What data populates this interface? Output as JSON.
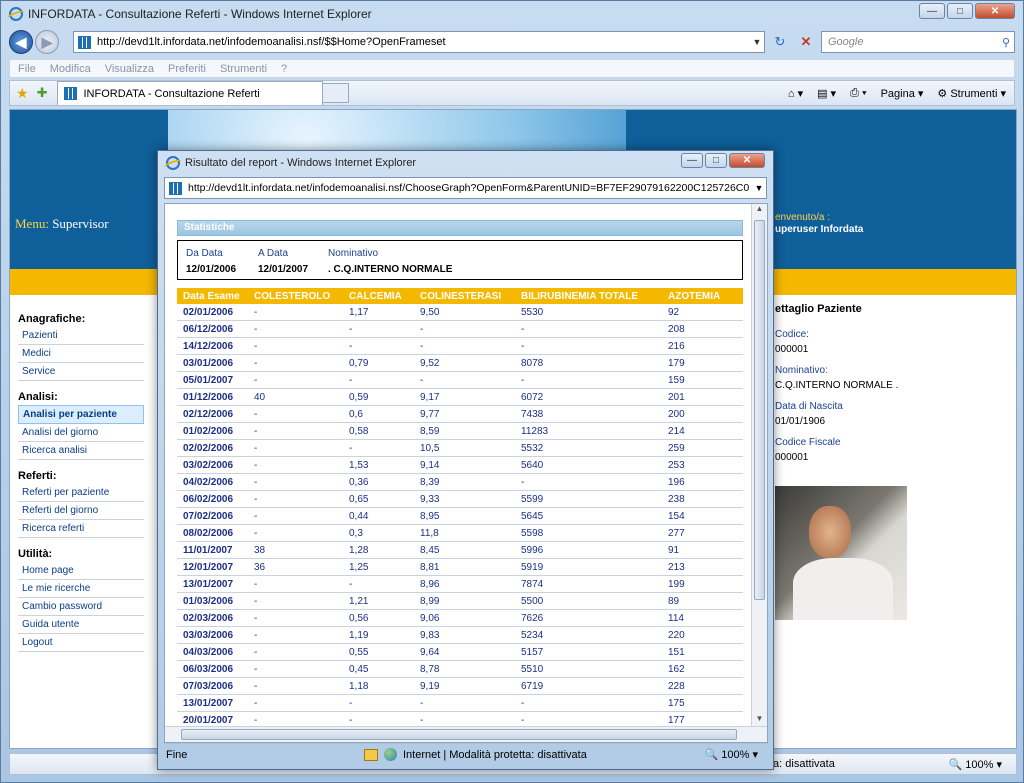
{
  "browser": {
    "title": "INFORDATA - Consultazione Referti - Windows Internet Explorer",
    "address": "http://devd1lt.infordata.net/infodemoanalisi.nsf/$$Home?OpenFrameset",
    "search_placeholder": "Google",
    "menu": [
      "File",
      "Modifica",
      "Visualizza",
      "Preferiti",
      "Strumenti",
      "?"
    ],
    "tab_label": "INFORDATA - Consultazione Referti",
    "tools": [
      "Pagina",
      "Strumenti"
    ],
    "status_text": "ta: disattivata",
    "zoom": "100%"
  },
  "header": {
    "menu_label": "Menu:",
    "menu_value": "Supervisor",
    "welcome_label": "envenuto/a :",
    "welcome_user": "uperuser Infordata"
  },
  "sidebar": {
    "sections": [
      {
        "title": "Anagrafiche:",
        "items": [
          "Pazienti",
          "Medici",
          "Service"
        ]
      },
      {
        "title": "Analisi:",
        "items": [
          "Analisi per paziente",
          "Analisi del giorno",
          "Ricerca analisi"
        ]
      },
      {
        "title": "Referti:",
        "items": [
          "Referti per paziente",
          "Referti del giorno",
          "Ricerca referti"
        ]
      },
      {
        "title": "Utilità:",
        "items": [
          "Home page",
          "Le mie ricerche",
          "Cambio password",
          "Guida utente",
          "Logout"
        ]
      }
    ]
  },
  "detail": {
    "title": "ettaglio Paziente",
    "codice_label": "Codice:",
    "codice": "000001",
    "nominativo_label": "Nominativo:",
    "nominativo": "C.Q.INTERNO NORMALE .",
    "nascita_label": "Data di Nascita",
    "nascita": "01/01/1906",
    "cf_label": "Codice Fiscale",
    "cf": "000001"
  },
  "popup": {
    "title": "Risultato del report - Windows Internet Explorer",
    "address": "http://devd1lt.infordata.net/infodemoanalisi.nsf/ChooseGraph?OpenForm&ParentUNID=BF7EF29079162200C125726C0",
    "section_title": "Statistiche",
    "filter": {
      "da_label": "Da Data",
      "da_value": "12/01/2006",
      "a_label": "A Data",
      "a_value": "12/01/2007",
      "nom_label": "Nominativo",
      "nom_value": ". C.Q.INTERNO NORMALE"
    },
    "columns": [
      "Data Esame",
      "COLESTEROLO",
      "CALCEMIA",
      "COLINESTERASI",
      "BILIRUBINEMIA TOTALE",
      "AZOTEMIA"
    ],
    "rows": [
      [
        "02/01/2006",
        "-",
        "1,17",
        "9,50",
        "5530",
        "92"
      ],
      [
        "06/12/2006",
        "-",
        "-",
        "-",
        "-",
        "208"
      ],
      [
        "14/12/2006",
        "-",
        "-",
        "-",
        "-",
        "216"
      ],
      [
        "03/01/2006",
        "-",
        "0,79",
        "9,52",
        "8078",
        "179"
      ],
      [
        "05/01/2007",
        "-",
        "-",
        "-",
        "-",
        "159"
      ],
      [
        "01/12/2006",
        "40",
        "0,59",
        "9,17",
        "6072",
        "201"
      ],
      [
        "02/12/2006",
        "-",
        "0,6",
        "9,77",
        "7438",
        "200"
      ],
      [
        "01/02/2006",
        "-",
        "0,58",
        "8,59",
        "11283",
        "214"
      ],
      [
        "02/02/2006",
        "-",
        "-",
        "10,5",
        "5532",
        "259"
      ],
      [
        "03/02/2006",
        "-",
        "1,53",
        "9,14",
        "5640",
        "253"
      ],
      [
        "04/02/2006",
        "-",
        "0,36",
        "8,39",
        "-",
        "196"
      ],
      [
        "06/02/2006",
        "-",
        "0,65",
        "9,33",
        "5599",
        "238"
      ],
      [
        "07/02/2006",
        "-",
        "0,44",
        "8,95",
        "5645",
        "154"
      ],
      [
        "08/02/2006",
        "-",
        "0,3",
        "11,8",
        "5598",
        "277"
      ],
      [
        "11/01/2007",
        "38",
        "1,28",
        "8,45",
        "5996",
        "91"
      ],
      [
        "12/01/2007",
        "36",
        "1,25",
        "8,81",
        "5919",
        "213"
      ],
      [
        "13/01/2007",
        "-",
        "-",
        "8,96",
        "7874",
        "199"
      ],
      [
        "01/03/2006",
        "-",
        "1,21",
        "8,99",
        "5500",
        "89"
      ],
      [
        "02/03/2006",
        "-",
        "0,56",
        "9,06",
        "7626",
        "114"
      ],
      [
        "03/03/2006",
        "-",
        "1,19",
        "9,83",
        "5234",
        "220"
      ],
      [
        "04/03/2006",
        "-",
        "0,55",
        "9,64",
        "5157",
        "151"
      ],
      [
        "06/03/2006",
        "-",
        "0,45",
        "8,78",
        "5510",
        "162"
      ],
      [
        "07/03/2006",
        "-",
        "1,18",
        "9,19",
        "6719",
        "228"
      ],
      [
        "13/01/2007",
        "-",
        "-",
        "-",
        "-",
        "175"
      ],
      [
        "20/01/2007",
        "-",
        "-",
        "-",
        "-",
        "177"
      ]
    ],
    "status_left": "Fine",
    "status_zone": "Internet | Modalità protetta: disattivata",
    "zoom": "100%"
  }
}
